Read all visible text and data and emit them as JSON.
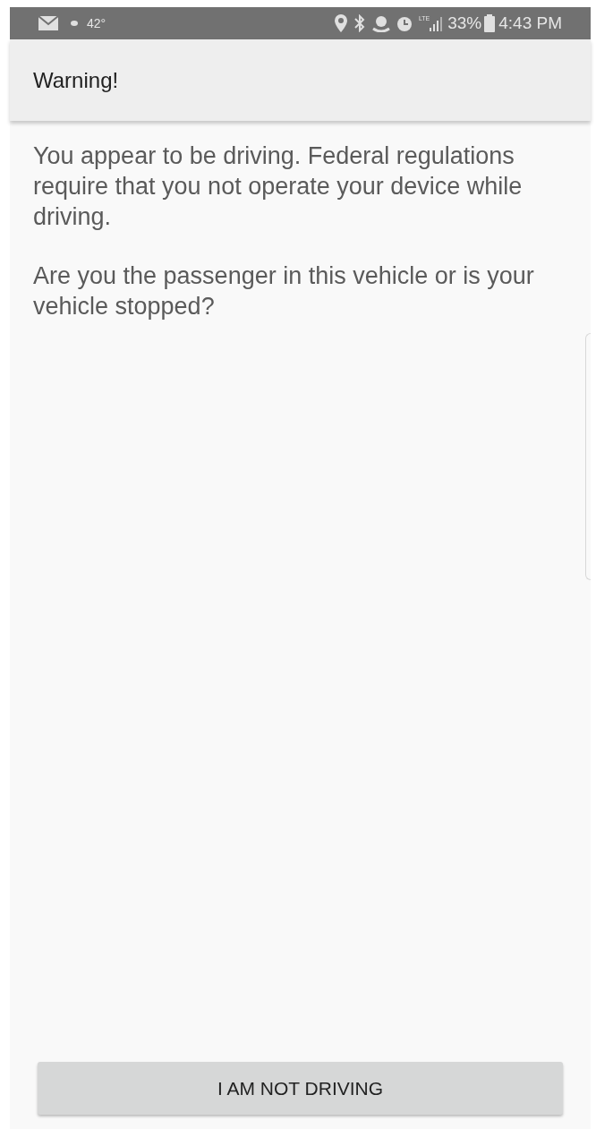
{
  "status_bar": {
    "temperature": "42°",
    "network": "LTE",
    "battery": "33%",
    "time": "4:43 PM"
  },
  "app_bar": {
    "title": "Warning!"
  },
  "message": [
    "You appear to be driving. Federal regulations require that you not operate your device while driving.",
    "Are you the passenger in this vehicle or is your vehicle stopped?"
  ],
  "button": {
    "label": "I AM NOT DRIVING"
  }
}
